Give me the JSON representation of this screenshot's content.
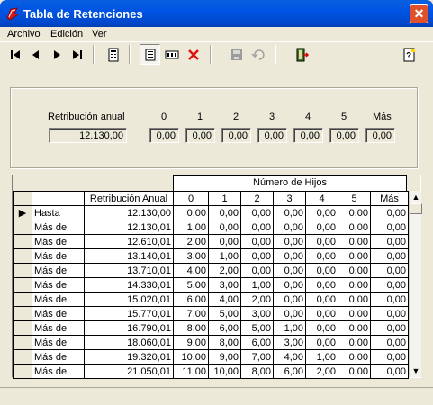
{
  "window": {
    "title": "Tabla de Retenciones",
    "close": "✕"
  },
  "menu": [
    {
      "label": "Archivo"
    },
    {
      "label": "Edición"
    },
    {
      "label": "Ver"
    }
  ],
  "toolbar": {
    "buttons": [
      {
        "icon": "first-record-icon"
      },
      {
        "icon": "previous-record-icon"
      },
      {
        "icon": "next-record-icon"
      },
      {
        "icon": "last-record-icon"
      },
      {
        "icon": "calculator-icon"
      },
      {
        "icon": "form-view-icon"
      },
      {
        "icon": "edit-field-icon"
      },
      {
        "icon": "delete-icon"
      },
      {
        "icon": "save-icon"
      },
      {
        "icon": "undo-icon"
      },
      {
        "icon": "exit-door-icon"
      },
      {
        "icon": "help-icon"
      }
    ]
  },
  "filter": {
    "label": "Retribución anual",
    "value": "12.130,00",
    "columns": [
      "0",
      "1",
      "2",
      "3",
      "4",
      "5",
      "Más"
    ],
    "values": [
      "0,00",
      "0,00",
      "0,00",
      "0,00",
      "0,00",
      "0,00",
      "0,00"
    ]
  },
  "grid": {
    "group_header": "Número de Hijos",
    "headers": [
      "",
      "Retribución Anual",
      "0",
      "1",
      "2",
      "3",
      "4",
      "5",
      "Más"
    ],
    "rows": [
      [
        "Hasta",
        "12.130,00",
        "0,00",
        "0,00",
        "0,00",
        "0,00",
        "0,00",
        "0,00",
        "0,00"
      ],
      [
        "Más de",
        "12.130,01",
        "1,00",
        "0,00",
        "0,00",
        "0,00",
        "0,00",
        "0,00",
        "0,00"
      ],
      [
        "Más de",
        "12.610,01",
        "2,00",
        "0,00",
        "0,00",
        "0,00",
        "0,00",
        "0,00",
        "0,00"
      ],
      [
        "Más de",
        "13.140,01",
        "3,00",
        "1,00",
        "0,00",
        "0,00",
        "0,00",
        "0,00",
        "0,00"
      ],
      [
        "Más de",
        "13.710,01",
        "4,00",
        "2,00",
        "0,00",
        "0,00",
        "0,00",
        "0,00",
        "0,00"
      ],
      [
        "Más de",
        "14.330,01",
        "5,00",
        "3,00",
        "1,00",
        "0,00",
        "0,00",
        "0,00",
        "0,00"
      ],
      [
        "Más de",
        "15.020,01",
        "6,00",
        "4,00",
        "2,00",
        "0,00",
        "0,00",
        "0,00",
        "0,00"
      ],
      [
        "Más de",
        "15.770,01",
        "7,00",
        "5,00",
        "3,00",
        "0,00",
        "0,00",
        "0,00",
        "0,00"
      ],
      [
        "Más de",
        "16.790,01",
        "8,00",
        "6,00",
        "5,00",
        "1,00",
        "0,00",
        "0,00",
        "0,00"
      ],
      [
        "Más de",
        "18.060,01",
        "9,00",
        "8,00",
        "6,00",
        "3,00",
        "0,00",
        "0,00",
        "0,00"
      ],
      [
        "Más de",
        "19.320,01",
        "10,00",
        "9,00",
        "7,00",
        "4,00",
        "1,00",
        "0,00",
        "0,00"
      ],
      [
        "Más de",
        "21.050,01",
        "11,00",
        "10,00",
        "8,00",
        "6,00",
        "2,00",
        "0,00",
        "0,00"
      ]
    ],
    "current_row": 0
  }
}
